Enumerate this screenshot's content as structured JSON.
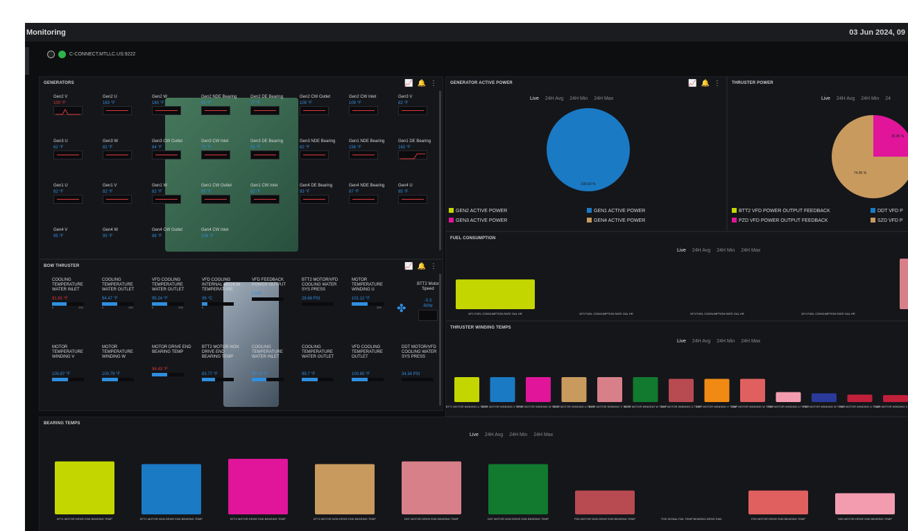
{
  "window": {
    "title": "Monitoring",
    "date": "03 Jun 2024, 09"
  },
  "connection": {
    "label": "C-CONNECT.MTLLC.US:9222"
  },
  "generators": {
    "title": "GENERATORS",
    "cells": [
      {
        "label": "Gen2 V",
        "value": "100 °F",
        "color": "red",
        "trend": "spike"
      },
      {
        "label": "Gen2 U",
        "value": "163 °F",
        "color": "blue",
        "trend": "flat"
      },
      {
        "label": "Gen2 W",
        "value": "160 °F",
        "color": "blue",
        "trend": "flat"
      },
      {
        "label": "Gen2 NDE Bearing",
        "value": "95 °F",
        "color": "blue",
        "trend": "flat"
      },
      {
        "label": "Gen2 DE Bearing",
        "value": "77 °F",
        "color": "blue",
        "trend": "flat"
      },
      {
        "label": "Gen2 CW Outlet",
        "value": "109 °F",
        "color": "blue",
        "trend": "flat"
      },
      {
        "label": "Gen2 CW Inlet",
        "value": "109 °F",
        "color": "blue",
        "trend": "flat"
      },
      {
        "label": "Gen3 V",
        "value": "82 °F",
        "color": "blue",
        "trend": "flat"
      },
      {
        "label": "Gen3 U",
        "value": "82 °F",
        "color": "blue",
        "trend": "flat"
      },
      {
        "label": "Gen3 W",
        "value": "82 °F",
        "color": "blue",
        "trend": "flat"
      },
      {
        "label": "Gen3 CW Outlet",
        "value": "84 °F",
        "color": "blue",
        "trend": "flat"
      },
      {
        "label": "Gen3 CW Inlet",
        "value": "72 °F",
        "color": "blue",
        "trend": "flat"
      },
      {
        "label": "Gen3 DE Bearing",
        "value": "92 °F",
        "color": "blue",
        "trend": "flat"
      },
      {
        "label": "Gen3 NDE Bearing",
        "value": "82 °F",
        "color": "blue",
        "trend": "flat"
      },
      {
        "label": "Gen1 NDE Bearing",
        "value": "156 °F",
        "color": "blue",
        "trend": "flat"
      },
      {
        "label": "Gen1 DE Bearing",
        "value": "163 °F",
        "color": "blue",
        "trend": "step"
      },
      {
        "label": "Gen1 U",
        "value": "82 °F",
        "color": "blue",
        "trend": "flat"
      },
      {
        "label": "Gen1 V",
        "value": "82 °F",
        "color": "blue",
        "trend": "flat"
      },
      {
        "label": "Gen1 W",
        "value": "82 °F",
        "color": "blue",
        "trend": "flat"
      },
      {
        "label": "Gen1 CW Outlet",
        "value": "95 °F",
        "color": "blue",
        "trend": "flat"
      },
      {
        "label": "Gen1 CW Inlet",
        "value": "82 °F",
        "color": "blue",
        "trend": "flat"
      },
      {
        "label": "Gen4 DE Bearing",
        "value": "93 °F",
        "color": "blue",
        "trend": "flat"
      },
      {
        "label": "Gen4 NDE Bearing",
        "value": "97 °F",
        "color": "blue",
        "trend": "flat"
      },
      {
        "label": "Gen4 U",
        "value": "95 °F",
        "color": "blue",
        "trend": "flat"
      },
      {
        "label": "Gen4 V",
        "value": "95 °F",
        "color": "blue",
        "trend": "none"
      },
      {
        "label": "Gen4 W",
        "value": "95 °F",
        "color": "blue",
        "trend": "none"
      },
      {
        "label": "Gen4 CW Outlet",
        "value": "88 °F",
        "color": "blue",
        "trend": "none"
      },
      {
        "label": "Gen4 CW Inlet",
        "value": "104 °F",
        "color": "blue",
        "trend": "none"
      }
    ]
  },
  "bow_thruster": {
    "title": "BOW THRUSTER",
    "speed_label": "BTT2 Motor Speed",
    "speed_value": "-0.3",
    "speed_unit": "RPM",
    "cells": [
      {
        "label": "COOLING TEMPERATURE WATER INLET",
        "value": "91.81 °F",
        "color": "red",
        "min": "0",
        "max": "200",
        "level": 0.46
      },
      {
        "label": "COOLING TEMPERATURE WATER OUTLET",
        "value": "94.47 °F",
        "color": "blue",
        "min": "0",
        "max": "200",
        "level": 0.47
      },
      {
        "label": "VFD COOLING TEMPERATURE WATER OUTLET",
        "value": "95.24 °F",
        "color": "blue",
        "min": "0",
        "max": "200",
        "level": 0.48
      },
      {
        "label": "VFD COOLING INTERNAL MEDIUM TEMPERATURE",
        "value": "36 °C",
        "color": "blue",
        "min": "0",
        "max": "",
        "level": 0.18
      },
      {
        "label": "VFD FEEDBACK POWER OUTPUT",
        "value": "0 kW",
        "color": "blue",
        "min": "",
        "max": "",
        "level": 0
      },
      {
        "label": "BTT2 MOTOR/VFD COOLING WATER SYS PRESS",
        "value": "28.68 PSI",
        "color": "blue",
        "min": "",
        "max": "",
        "level": 0
      },
      {
        "label": "MOTOR TEMPERATURE WINDING U",
        "value": "101.12 °F",
        "color": "blue",
        "min": "",
        "max": "200",
        "level": 0.5
      },
      {
        "label": "MOTOR TEMPERATURE WINDING V",
        "value": "100.87 °F",
        "color": "blue",
        "min": "",
        "max": "",
        "level": 0.5
      },
      {
        "label": "MOTOR TEMPERATURE WINDING W",
        "value": "100.79 °F",
        "color": "blue",
        "min": "",
        "max": "",
        "level": 0.5
      },
      {
        "label": "MOTOR DRIVE END BEARING TEMP",
        "value": "94.43 °F",
        "color": "red",
        "min": "",
        "max": "",
        "level": 0.47
      },
      {
        "label": "BTT2 MOTOR NON DRIVE END BEARING TEMP",
        "value": "83.77 °F",
        "color": "blue",
        "min": "",
        "max": "",
        "level": 0.42
      },
      {
        "label": "COOLING TEMPERATURE WATER INLET",
        "value": "90.74 °F",
        "color": "blue",
        "min": "",
        "max": "",
        "level": 0.45
      },
      {
        "label": "COOLING TEMPERATURE WATER OUTLET",
        "value": "99.7 °F",
        "color": "blue",
        "min": "",
        "max": "",
        "level": 0.5
      },
      {
        "label": "VFD COOLING TEMPERATURE OUTLET",
        "value": "100.85 °F",
        "color": "blue",
        "min": "",
        "max": "",
        "level": 0.5
      },
      {
        "label": "DDT MOTOR/VFD COOLING WATER SYS PRESS",
        "value": "34.34 PSI",
        "color": "blue",
        "min": "",
        "max": "",
        "level": 0
      }
    ]
  },
  "tabs": [
    "Live",
    "24H Avg",
    "24H Min",
    "24H Max"
  ],
  "gen_active_power": {
    "title": "GENERATOR ACTIVE POWER",
    "legend": [
      {
        "label": "GEN2 ACTIVE POWER",
        "color": "#c4d600"
      },
      {
        "label": "GEN1 ACTIVE POWER",
        "color": "#1a7ac4"
      },
      {
        "label": "GEN3 ACTIVE POWER",
        "color": "#e0159a"
      },
      {
        "label": "GEN4 ACTIVE POWER",
        "color": "#c89a5e"
      }
    ],
    "chart_data": {
      "type": "pie",
      "labels": [
        "GEN1 ACTIVE POWER"
      ],
      "values": [
        100.0
      ],
      "slice_label": "100.00 %"
    }
  },
  "thruster_power": {
    "title": "THRUSTER POWER",
    "tabs": [
      "Live",
      "24H Avg",
      "24H Min",
      "24"
    ],
    "legend": [
      {
        "label": "BTT2 VFD POWER OUTPUT FEEDBACK",
        "color": "#c4d600"
      },
      {
        "label": "DDT VFD P",
        "color": "#1a7ac4"
      },
      {
        "label": "PZD VFD POWER OUTPUT FEEDBACK",
        "color": "#e0159a"
      },
      {
        "label": "SZD VFD P",
        "color": "#c89a5e"
      }
    ],
    "chart_data": {
      "type": "pie",
      "labels": [
        "SZD VFD P",
        "PZD VFD POWER OUTPUT FEEDBACK"
      ],
      "values": [
        74.95,
        25.05
      ],
      "slice_labels": [
        "74.95 %",
        "25.05 %"
      ]
    }
  },
  "fuel": {
    "title": "FUEL CONSUMPTION",
    "chart_data": {
      "type": "bar",
      "categories": [
        "DF1 FUEL CONSUMPTION RATE GAL HR",
        "DF2 FUEL CONSUMPTION RATE GAL HR",
        "DF3 FUEL CONSUMPTION RATE GAL HR",
        "DF4 FUEL CONSUMPTION RATE GAL HR",
        "E DF FU"
      ],
      "values": [
        100,
        0,
        0,
        0,
        170
      ],
      "colors": [
        "#c4d600",
        "#1a7ac4",
        "#e0159a",
        "#c89a5e",
        "#d8808a"
      ],
      "ylim": [
        0,
        175
      ]
    }
  },
  "winding": {
    "title": "THRUSTER WINDING TEMPS",
    "chart_data": {
      "type": "bar",
      "categories": [
        "BTT1 MOTOR WINDING U TEMP",
        "BTT1 MOTOR WINDING V TEMP",
        "BTT1 MOTOR WINDING W TEMP",
        "BTT2 MOTOR WINDING U TEMP",
        "BTT2 MOTOR WINDING V TEMP",
        "BTT2 MOTOR WINDING W TEMP",
        "DDT MOTOR WINDING U TEMP",
        "DDT MOTOR WINDING V TEMP",
        "DDT MOTOR WINDING W TEMP",
        "PZD MOTOR WINDING U TEMP",
        "PZD MOTOR WINDING W TEMP",
        "SZD MOTOR WINDING U TEMP",
        "SZD MOTOR WINDING V TEMP"
      ],
      "values": [
        100,
        100,
        100,
        100,
        100,
        100,
        93,
        93,
        93,
        40,
        35,
        30,
        28
      ],
      "colors": [
        "#c4d600",
        "#1a7ac4",
        "#e0159a",
        "#c89a5e",
        "#d8808a",
        "#117a2e",
        "#b84a52",
        "#f08a14",
        "#e06060",
        "#f39cb0",
        "#2a3a9a",
        "#c0203a",
        "#c0203a"
      ],
      "ylim": [
        0,
        100
      ]
    }
  },
  "bearing": {
    "title": "BEARING TEMPS",
    "chart_data": {
      "type": "bar",
      "categories": [
        "BTT1 MOTOR DRIVE END BEARING TEMP",
        "BTT1 MOTOR NON DRIVE END BEARING TEMP",
        "BTT2 MOTOR DRIVE END BEARING TEMP",
        "BTT2 MOTOR NON DRIVE END BEARING TEMP",
        "DDT MOTOR DRIVE END BEARING TEMP",
        "DDT MOTOR NON DRIVE END BEARING TEMP",
        "PZD MOTOR NON DRIVE END BEARING TEMP",
        "PZD SIGNAL FAIL TEMP BEARING DRIVE END",
        "PZD MOTOR DRIVE END BEARING TEMP",
        "SZD MOTOR DRIVE END BEARING TEMP",
        "SZ"
      ],
      "values": [
        100,
        95,
        105,
        95,
        100,
        95,
        45,
        0,
        45,
        40,
        0
      ],
      "colors": [
        "#c4d600",
        "#1a7ac4",
        "#e0159a",
        "#c89a5e",
        "#d8808a",
        "#117a2e",
        "#b84a52",
        "#f08a14",
        "#e06060",
        "#f39cb0",
        "#2a3a9a"
      ],
      "ylim": [
        0,
        110
      ]
    }
  }
}
